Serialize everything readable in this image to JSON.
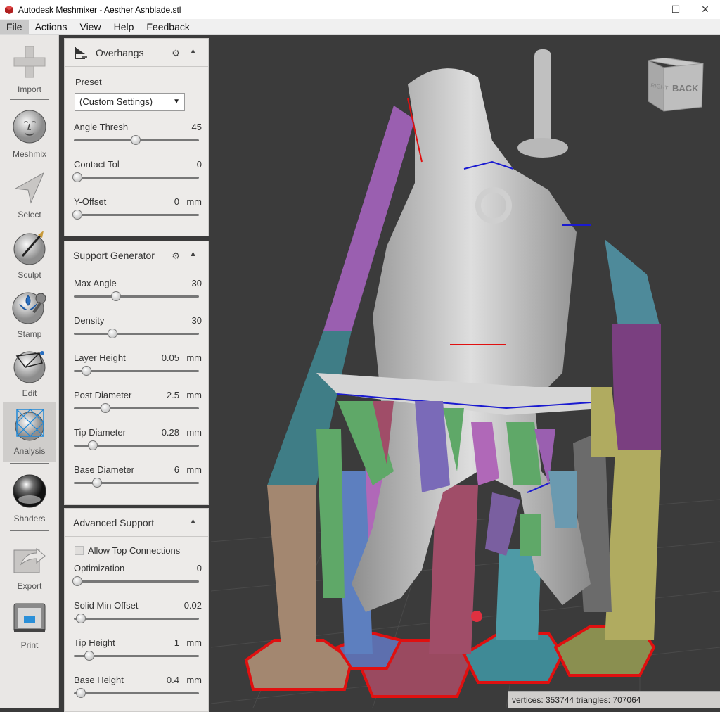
{
  "window": {
    "title": "Autodesk Meshmixer - Aesther Ashblade.stl",
    "minimize": "—",
    "maximize": "☐",
    "close": "✕"
  },
  "menu": [
    "File",
    "Actions",
    "View",
    "Help",
    "Feedback"
  ],
  "tools": [
    {
      "label": "Import",
      "icon": "plus-icon"
    },
    {
      "label": "Meshmix",
      "icon": "face-sphere-icon"
    },
    {
      "label": "Select",
      "icon": "arrow-cursor-icon"
    },
    {
      "label": "Sculpt",
      "icon": "brush-sphere-icon"
    },
    {
      "label": "Stamp",
      "icon": "stamp-sphere-icon"
    },
    {
      "label": "Edit",
      "icon": "mesh-edit-icon"
    },
    {
      "label": "Analysis",
      "icon": "analysis-mesh-icon"
    },
    {
      "label": "Shaders",
      "icon": "chrome-sphere-icon"
    },
    {
      "label": "Export",
      "icon": "export-arrow-icon"
    },
    {
      "label": "Print",
      "icon": "printer-icon"
    }
  ],
  "overhangs": {
    "title": "Overhangs",
    "preset_label": "Preset",
    "preset_value": "(Custom Settings)",
    "params": [
      {
        "name": "Angle Thresh",
        "value": "45",
        "unit": "",
        "slider": 0.5
      },
      {
        "name": "Contact Tol",
        "value": "0",
        "unit": "",
        "slider": 0.0
      },
      {
        "name": "Y-Offset",
        "value": "0",
        "unit": "mm",
        "slider": 0.0
      }
    ]
  },
  "support_generator": {
    "title": "Support Generator",
    "params": [
      {
        "name": "Max Angle",
        "value": "30",
        "unit": "",
        "slider": 0.33
      },
      {
        "name": "Density",
        "value": "30",
        "unit": "",
        "slider": 0.3
      },
      {
        "name": "Layer Height",
        "value": "0.05",
        "unit": "mm",
        "slider": 0.08
      },
      {
        "name": "Post Diameter",
        "value": "2.5",
        "unit": "mm",
        "slider": 0.24
      },
      {
        "name": "Tip Diameter",
        "value": "0.28",
        "unit": "mm",
        "slider": 0.13
      },
      {
        "name": "Base Diameter",
        "value": "6",
        "unit": "mm",
        "slider": 0.17
      }
    ]
  },
  "advanced_support": {
    "title": "Advanced Support",
    "allow_top_label": "Allow Top Connections",
    "params": [
      {
        "name": "Optimization",
        "value": "0",
        "unit": "",
        "slider": 0.0
      },
      {
        "name": "Solid Min Offset",
        "value": "0.02",
        "unit": "",
        "slider": 0.03
      },
      {
        "name": "Tip Height",
        "value": "1",
        "unit": "mm",
        "slider": 0.1
      },
      {
        "name": "Base Height",
        "value": "0.4",
        "unit": "mm",
        "slider": 0.03
      }
    ]
  },
  "viewcube": {
    "right": "RIGHT",
    "back": "BACK"
  },
  "status": "vertices: 353744 triangles: 707064",
  "colors": {
    "background": "#3b3b3b",
    "panel": "#edebe9",
    "toolbar": "#e9e7e5",
    "overhang_outline": "#e01010",
    "edge_highlight": "#1a1ad0"
  }
}
